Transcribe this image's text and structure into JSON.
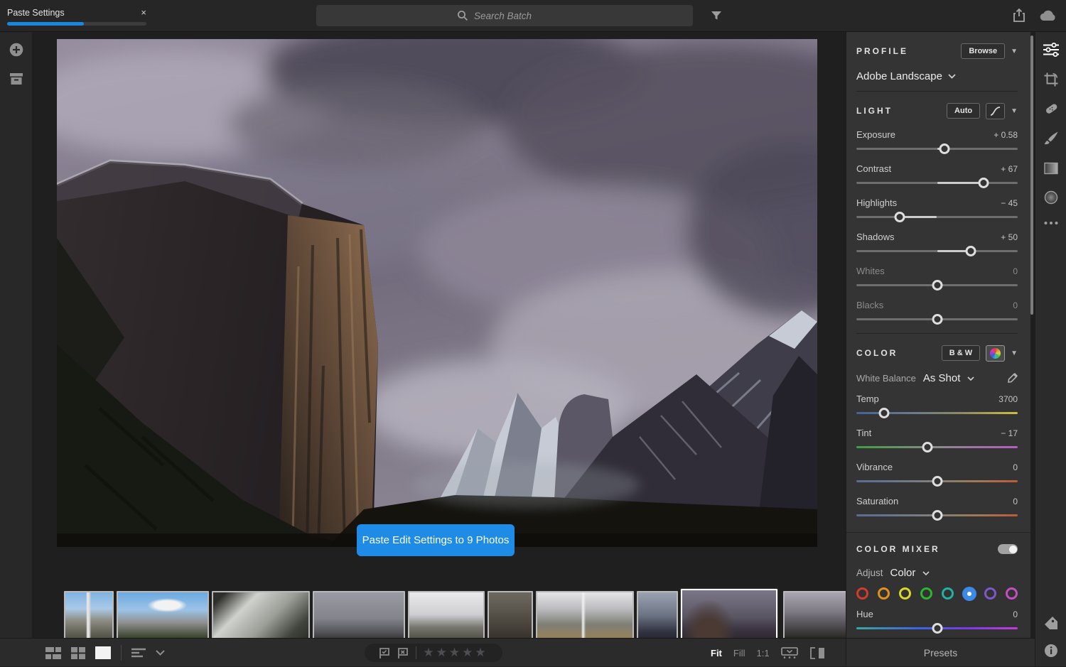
{
  "topbar": {
    "tab_label": "Paste Settings",
    "progress_percent": 55,
    "close_glyph": "×",
    "search_placeholder": "Search Batch"
  },
  "photo_overlay": {
    "paste_button_label": "Paste Edit Settings to 9 Photos"
  },
  "panel": {
    "profile": {
      "header": "PROFILE",
      "browse_label": "Browse",
      "profile_name": "Adobe Landscape"
    },
    "light": {
      "header": "LIGHT",
      "auto_label": "Auto",
      "sliders": [
        {
          "label": "Exposure",
          "value": "+ 0.58",
          "pos": 54.5
        },
        {
          "label": "Contrast",
          "value": "+ 67",
          "pos": 79
        },
        {
          "label": "Highlights",
          "value": "− 45",
          "pos": 27
        },
        {
          "label": "Shadows",
          "value": "+ 50",
          "pos": 71
        },
        {
          "label": "Whites",
          "value": "0",
          "pos": 50
        },
        {
          "label": "Blacks",
          "value": "0",
          "pos": 50
        }
      ]
    },
    "color": {
      "header": "COLOR",
      "bw_label": "B & W",
      "white_balance_label": "White Balance",
      "white_balance_value": "As Shot",
      "sliders": [
        {
          "label": "Temp",
          "value": "3700",
          "pos": 17
        },
        {
          "label": "Tint",
          "value": "− 17",
          "pos": 44
        },
        {
          "label": "Vibrance",
          "value": "0",
          "pos": 50
        },
        {
          "label": "Saturation",
          "value": "0",
          "pos": 50
        }
      ]
    },
    "mixer": {
      "header": "COLOR MIXER",
      "adjust_label": "Adjust",
      "adjust_value": "Color",
      "dot_colors": [
        "#d23c2a",
        "#e2901e",
        "#d9d826",
        "#2eb52e",
        "#21b3a1",
        "#3c8ae8",
        "#7e57c9",
        "#c44fc4"
      ],
      "selected_dot_index": 5,
      "hue_slider": {
        "label": "Hue",
        "value": "0",
        "pos": 50
      }
    },
    "footer_label": "Presets"
  },
  "toolbar": {
    "zoom_fit": "Fit",
    "zoom_fill": "Fill",
    "zoom_1to1": "1:1"
  },
  "filmstrip": {
    "photo_count": 10
  }
}
